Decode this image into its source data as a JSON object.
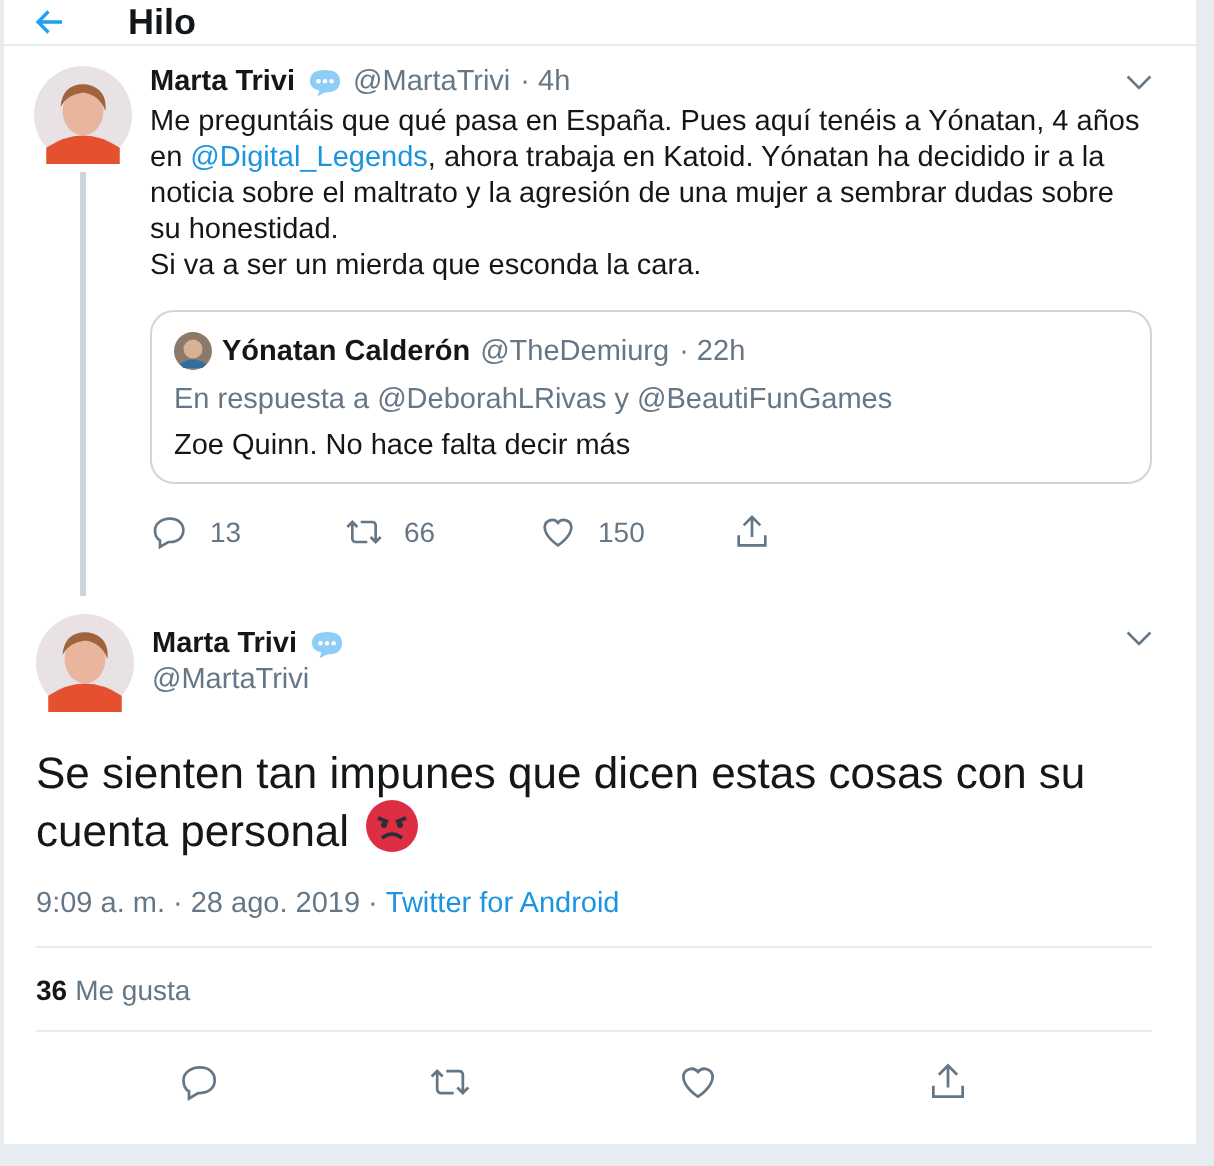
{
  "header": {
    "title": "Hilo"
  },
  "parent_tweet": {
    "name": "Marta Trivi",
    "handle": "@MartaTrivi",
    "time": "· 4h",
    "text_lines": [
      [
        {
          "kind": "text",
          "text": "Me preguntáis que qué pasa en España. Pues aquí tenéis a Yónatan, 4 años en "
        },
        {
          "kind": "mention",
          "text": "@Digital_Legends"
        },
        {
          "kind": "text",
          "text": ", ahora trabaja en Katoid. Yónatan ha decidido ir a la noticia sobre el maltrato y la agresión de una mujer a sembrar dudas sobre su honestidad."
        }
      ],
      [
        {
          "kind": "text",
          "text": "Si va a ser un mierda que esconda la cara."
        }
      ]
    ],
    "quoted": {
      "name": "Yónatan Calderón",
      "handle": "@TheDemiurg",
      "time": "· 22h",
      "reply_to": "En respuesta a @DeborahLRivas y @BeautiFunGames",
      "text": "Zoe Quinn. No hace falta decir más"
    },
    "actions": [
      {
        "kind": "reply",
        "count": "13"
      },
      {
        "kind": "retweet",
        "count": "66"
      },
      {
        "kind": "like",
        "count": "150"
      },
      {
        "kind": "share"
      }
    ]
  },
  "main_tweet": {
    "name": "Marta Trivi",
    "handle": "@MartaTrivi",
    "text_lines": [
      "Se sienten tan impunes que dicen estas cosas con su",
      "cuenta personal"
    ],
    "timestamp": "9:09 a. m. · 28 ago. 2019 ·",
    "source": "Twitter for Android",
    "likes_count": "36",
    "likes_label": "Me gusta",
    "actions": [
      {
        "kind": "reply"
      },
      {
        "kind": "retweet"
      },
      {
        "kind": "like"
      },
      {
        "kind": "share"
      }
    ]
  }
}
